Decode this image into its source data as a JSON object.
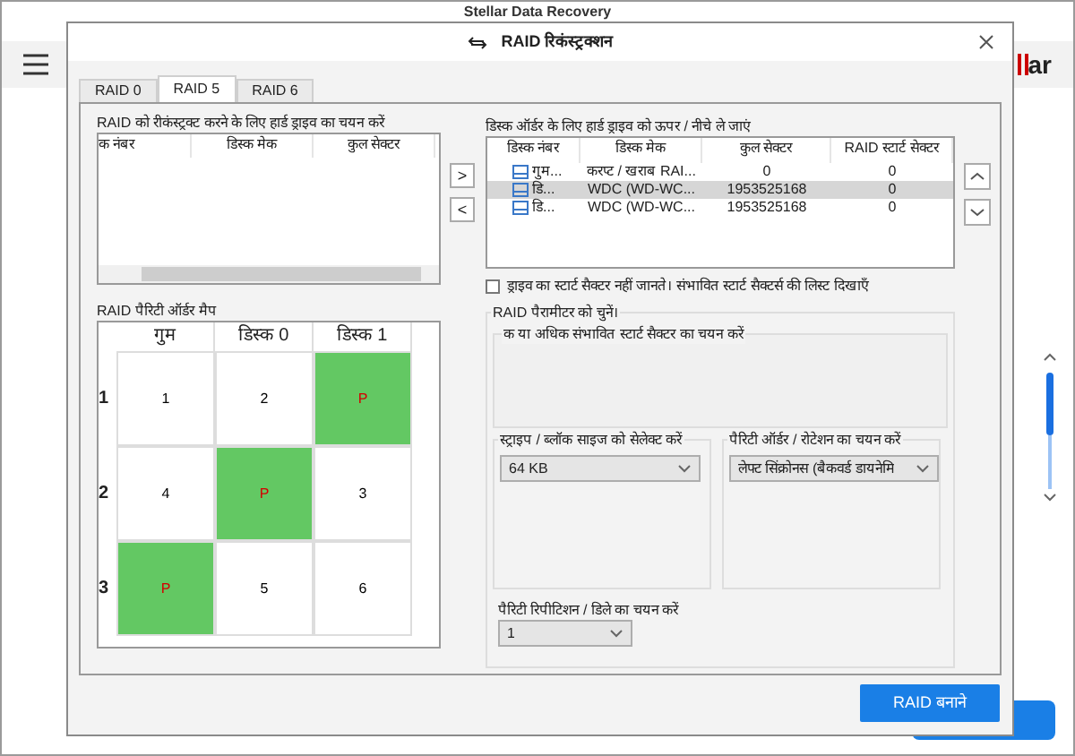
{
  "app": {
    "title": "Stellar Data Recovery",
    "logo_text": "ar"
  },
  "dialog": {
    "title": "RAID रिकंस्ट्रक्शन",
    "tabs": [
      {
        "label": "RAID 0",
        "selected": false
      },
      {
        "label": "RAID 5",
        "selected": true
      },
      {
        "label": "RAID 6",
        "selected": false
      }
    ],
    "drive_select": {
      "label": "RAID को रीकंस्ट्रक्ट करने के लिए हार्ड ड्राइव का चयन करें",
      "columns": [
        "क नंबर",
        "डिस्क मेक",
        "कुल सेक्टर"
      ]
    },
    "move_buttons": [
      ">",
      "<"
    ],
    "disk_order": {
      "label": "डिस्क ऑर्डर के लिए हार्ड ड्राइव को ऊपर / नीचे ले जाएं",
      "columns": [
        "डिस्क नंबर",
        "डिस्क मेक",
        "कुल सेक्टर",
        "RAID स्टार्ट सेक्टर"
      ],
      "rows": [
        {
          "disk": "गुम...",
          "make": "करप्ट / खराब RAI...",
          "sectors": "0",
          "start": "0",
          "selected": false
        },
        {
          "disk": "डि...",
          "make": "WDC (WD-WC...",
          "sectors": "1953525168",
          "start": "0",
          "selected": true
        },
        {
          "disk": "डि...",
          "make": "WDC (WD-WC...",
          "sectors": "1953525168",
          "start": "0",
          "selected": false
        }
      ]
    },
    "start_sector_checkbox": {
      "label": "ड्राइव का स्टार्ट सैक्टर नहीं जानते। संभावित स्टार्ट सैक्टर्स की लिस्ट दिखाएँ",
      "checked": false
    },
    "parity_map": {
      "label": "RAID पैरिटी ऑर्डर मैप",
      "columns": [
        "गुम",
        "डिस्क 0",
        "डिस्क 1"
      ],
      "rows": [
        {
          "label": "1",
          "cells": [
            {
              "text": "1",
              "parity": false
            },
            {
              "text": "2",
              "parity": false
            },
            {
              "text": "P",
              "parity": true
            }
          ]
        },
        {
          "label": "2",
          "cells": [
            {
              "text": "4",
              "parity": false
            },
            {
              "text": "P",
              "parity": true
            },
            {
              "text": "3",
              "parity": false
            }
          ]
        },
        {
          "label": "3",
          "cells": [
            {
              "text": "P",
              "parity": true
            },
            {
              "text": "5",
              "parity": false
            },
            {
              "text": "6",
              "parity": false
            }
          ]
        }
      ]
    },
    "params": {
      "label": "RAID पैरामीटर को चुनें।",
      "start_sectors_label": "क या अधिक संभावित स्टार्ट सैक्टर का चयन करें",
      "stripe": {
        "label": "स्ट्राइप / ब्लॉक साइज को सेलेक्ट करें",
        "value": "64 KB"
      },
      "parity_order": {
        "label": "पैरिटी ऑर्डर / रोटेशन का चयन करें",
        "value": "लेफ्ट सिंक्रोनस (बैकवर्ड डायनेमि"
      },
      "repetition": {
        "label": "पैरिटी रिपीटिशन / डिले का चयन करें",
        "value": "1"
      }
    },
    "create_button": "RAID बनाने"
  }
}
